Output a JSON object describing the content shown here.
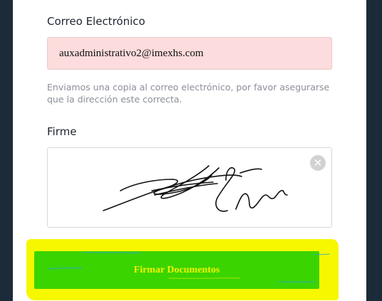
{
  "form": {
    "email_label": "Correo Electrónico",
    "email_value": "auxadministrativo2@imexhs.com",
    "help_text": "Enviamos una copia al correo electrónico, por favor asegurarse que la dirección este correcta.",
    "signature_label": "Firme",
    "clear_glyph": "✕",
    "submit_label": "Firmar Documentos"
  },
  "colors": {
    "background": "#1b2b3a",
    "email_error_bg": "#fcdcdc",
    "submit_bg": "#3ad400",
    "highlight": "#f7f700"
  },
  "icons": {
    "clear": "close-circle-icon"
  }
}
